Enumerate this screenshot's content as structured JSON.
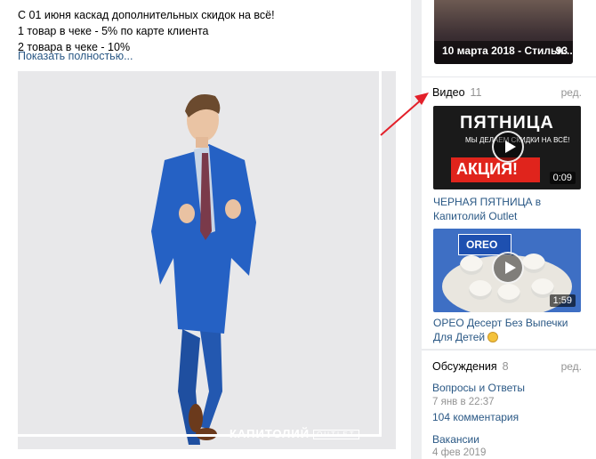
{
  "post": {
    "lines": [
      "С 01 июня каскад дополнительных скидок на всё!",
      "1 товар в чеке - 5% по карте клиента",
      "2 товара в чеке - 10%"
    ],
    "show_more": "Показать полностью...",
    "photo_brand": "КАПИТОЛИЙ",
    "photo_brand_sub": "OUTLET"
  },
  "album": {
    "caption": "10 марта 2018 - Стильн...",
    "count": "93"
  },
  "videos": {
    "title": "Видео",
    "count": "11",
    "edit": "ред.",
    "items": [
      {
        "title": "ЧЕРНАЯ ПЯТНИЦА в Капитолий Outlet",
        "duration": "0:09",
        "thumb_text_1": "ПЯТНИЦА",
        "thumb_text_2": "МЫ ДЕЛАЕМ СКИДКИ НА ВСЁ!",
        "thumb_text_3": "АКЦИЯ!"
      },
      {
        "title": "ОРЕО Десерт Без Выпечки Для Детей",
        "duration": "1:59",
        "thumb_text_1": "OREO"
      }
    ]
  },
  "discussions": {
    "title": "Обсуждения",
    "count": "8",
    "edit": "ред.",
    "items": [
      {
        "title": "Вопросы и Ответы",
        "date": "7 янв в 22:37",
        "comments": "104 комментария"
      },
      {
        "title": "Вакансии",
        "date": "4 фев 2019"
      }
    ]
  },
  "colors": {
    "link": "#2a5885",
    "muted": "#939393",
    "arrow": "#e3202a"
  }
}
